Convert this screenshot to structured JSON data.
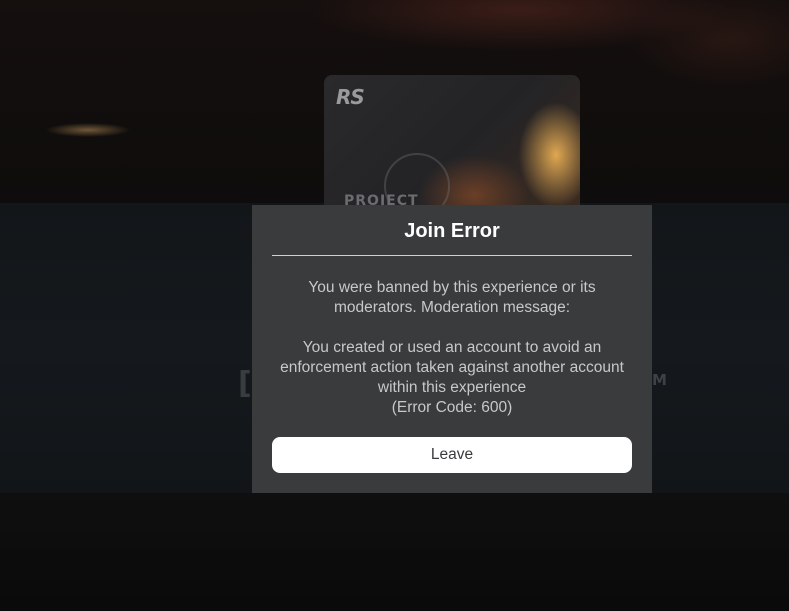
{
  "background": {
    "bracket_glyph": "[",
    "partial_letter": "M"
  },
  "thumbnail": {
    "logo_text": "RS",
    "caption_text": "PROJECT"
  },
  "dialog": {
    "title": "Join Error",
    "message_lines": [
      "You were banned by this experience or its",
      "moderators. Moderation message:"
    ],
    "reason_lines": [
      "You created or used an account to avoid an",
      "enforcement action taken against another account",
      "within this experience"
    ],
    "error_code": "(Error Code: 600)",
    "leave_label": "Leave"
  },
  "colors": {
    "dialog_bg": "#393b3d",
    "button_bg": "#ffffff",
    "title_text": "#ffffff",
    "body_text": "#c8c8c8"
  }
}
